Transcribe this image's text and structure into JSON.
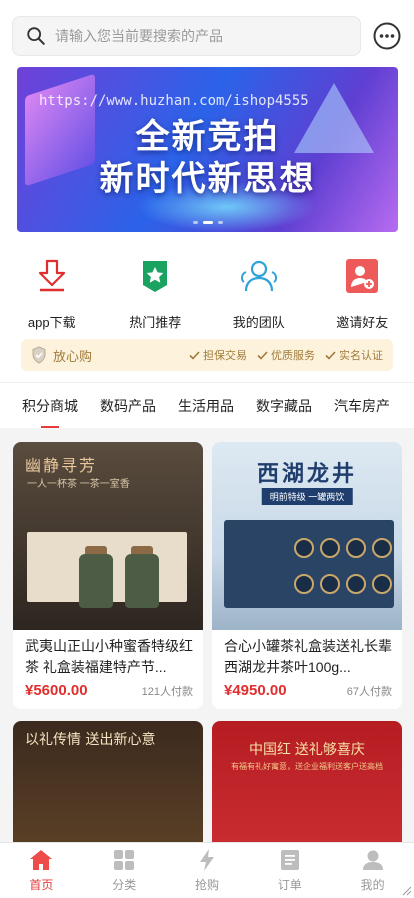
{
  "search": {
    "placeholder": "请输入您当前要搜索的产品"
  },
  "banner": {
    "watermark": "https://www.huzhan.com/ishop4555",
    "line1": "全新竞拍",
    "line2": "新时代新思想"
  },
  "quick_links": [
    {
      "label": "app下载",
      "icon": "download-icon"
    },
    {
      "label": "热门推荐",
      "icon": "star-badge-icon"
    },
    {
      "label": "我的团队",
      "icon": "team-icon"
    },
    {
      "label": "邀请好友",
      "icon": "invite-icon"
    }
  ],
  "guarantee": {
    "title": "放心购",
    "tags": [
      "担保交易",
      "优质服务",
      "实名认证"
    ]
  },
  "category_tabs": [
    "积分商城",
    "数码产品",
    "生活用品",
    "数字藏品",
    "汽车房产"
  ],
  "products": [
    {
      "name": "武夷山正山小种蜜香特级红茶 礼盒装福建特产节...",
      "price": "¥5600.00",
      "buyers": "121人付款",
      "image_text": "幽静寻芳",
      "image_sub": "一人一杯茶 一茶一室香"
    },
    {
      "name": "合心小罐茶礼盒装送礼长辈西湖龙井茶叶100g...",
      "price": "¥4950.00",
      "buyers": "67人付款",
      "image_text": "西湖龙井",
      "image_sub": "明前特级 一罐两饮"
    },
    {
      "image_text": "以礼传情 送出新心意"
    },
    {
      "image_text": "中国红 送礼够喜庆",
      "image_sub": "有福有礼好寓意，送企业福利送客户送高档"
    }
  ],
  "tabbar": [
    {
      "label": "首页",
      "icon": "home-icon",
      "active": true
    },
    {
      "label": "分类",
      "icon": "category-icon",
      "active": false
    },
    {
      "label": "抢购",
      "icon": "flash-icon",
      "active": false
    },
    {
      "label": "订单",
      "icon": "order-icon",
      "active": false
    },
    {
      "label": "我的",
      "icon": "user-icon",
      "active": false
    }
  ],
  "colors": {
    "accent": "#e33b3b",
    "price": "#e02e2e",
    "guarantee_bg": "#fdf3dc"
  }
}
